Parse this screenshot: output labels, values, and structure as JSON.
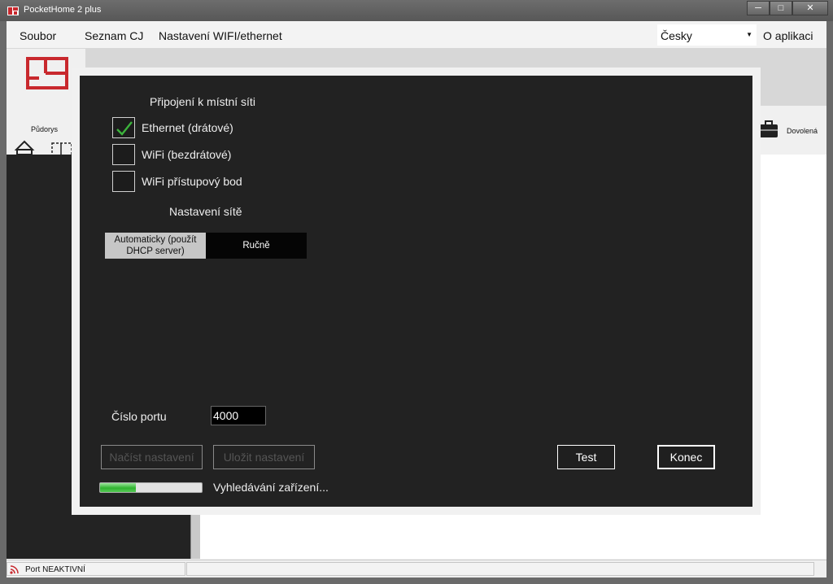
{
  "window": {
    "title": "PocketHome 2 plus",
    "minimize_icon": "minimize-icon",
    "maximize_icon": "maximize-icon",
    "close_icon": "close-icon"
  },
  "menu": {
    "items": [
      "Soubor",
      "Seznam CJ",
      "Nastavení WIFI/ethernet"
    ],
    "language": "Česky",
    "about": "O aplikaci"
  },
  "toolbar": {
    "pudorys_label": "Půdorys",
    "dovolena_label": "Dovolená"
  },
  "dialog": {
    "local_network_heading": "Připojení k místní síti",
    "options": [
      {
        "label": "Ethernet (drátové)",
        "checked": true
      },
      {
        "label": "WiFi (bezdrátové)",
        "checked": false
      },
      {
        "label": "WiFi přístupový bod",
        "checked": false
      }
    ],
    "network_settings_heading": "Nastavení sítě",
    "mode_auto": "Automaticky (použít DHCP server)",
    "mode_manual": "Ručně",
    "selected_mode": "Automaticky (použít DHCP server)",
    "port_label": "Číslo portu",
    "port_value": "4000",
    "load_button": "Načíst nastavení",
    "save_button": "Uložit nastavení",
    "test_button": "Test",
    "close_button": "Konec",
    "progress_fraction": 0.35,
    "status_text": "Vyhledávání zařízení..."
  },
  "statusbar": {
    "port_status": "Port NEAKTIVNÍ"
  },
  "colors": {
    "check_green": "#3cb33c",
    "brand_red": "#c8282d",
    "dialog_bg": "#222222"
  }
}
